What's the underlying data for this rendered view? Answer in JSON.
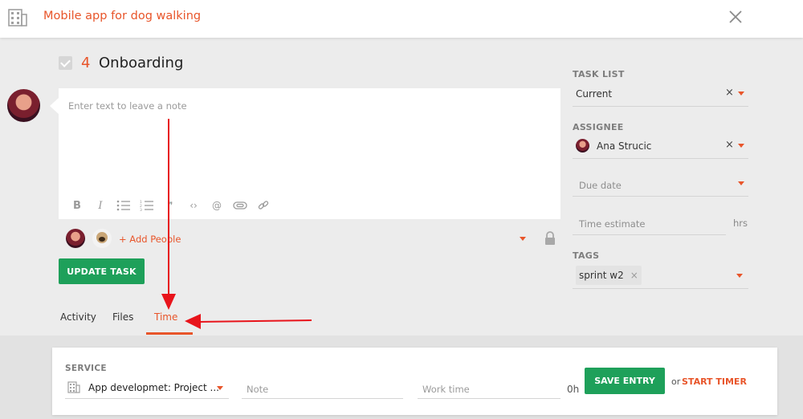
{
  "header": {
    "project_title": "Mobile app for dog walking"
  },
  "task": {
    "number": "4",
    "name": "Onboarding"
  },
  "note": {
    "placeholder": "Enter text to leave a note",
    "toolbar": [
      {
        "name": "bold-icon",
        "glyph": "B"
      },
      {
        "name": "italic-icon",
        "glyph": "I"
      },
      {
        "name": "bullet-list-icon",
        "glyph": "☰"
      },
      {
        "name": "numbered-list-icon",
        "glyph": "☰"
      },
      {
        "name": "quote-icon",
        "glyph": "❞"
      },
      {
        "name": "code-icon",
        "glyph": "‹›"
      },
      {
        "name": "mention-icon",
        "glyph": "@"
      },
      {
        "name": "attachment-icon",
        "glyph": "⊂⊃"
      },
      {
        "name": "link-icon",
        "glyph": "⚭"
      }
    ]
  },
  "people": {
    "add_label": "+ Add People"
  },
  "actions": {
    "update_label": "UPDATE TASK"
  },
  "tabs": [
    {
      "label": "Activity"
    },
    {
      "label": "Files"
    },
    {
      "label": "Time",
      "active": true
    }
  ],
  "sidebar": {
    "task_list": {
      "label": "TASK LIST",
      "value": "Current"
    },
    "assignee": {
      "label": "ASSIGNEE",
      "value": "Ana Strucic"
    },
    "due_date": {
      "placeholder": "Due date"
    },
    "time_estimate": {
      "placeholder": "Time estimate",
      "unit": "hrs"
    },
    "tags": {
      "label": "TAGS",
      "values": [
        "sprint w2"
      ]
    }
  },
  "time_entry": {
    "service_label": "SERVICE",
    "service_value": "App developmet: Project ...",
    "note_placeholder": "Note",
    "work_time_placeholder": "Work time",
    "total": "0h",
    "save_label": "SAVE ENTRY",
    "or_label": "or",
    "start_timer_label": "START TIMER"
  },
  "colors": {
    "accent": "#e8552a",
    "primary_button": "#1ea05a",
    "annotation_arrow": "#e8141b"
  }
}
